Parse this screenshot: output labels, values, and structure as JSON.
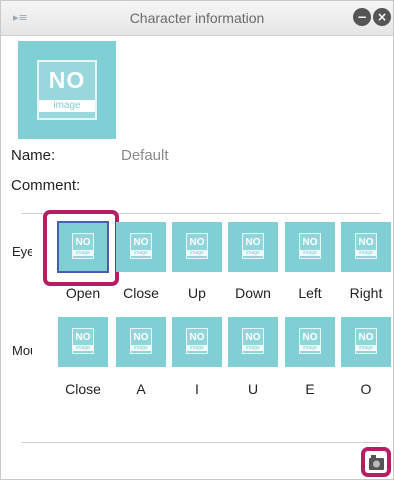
{
  "window": {
    "title": "Character information",
    "grip_icon": "panel-menu-icon",
    "minimize_icon": "minimize-icon",
    "close_icon": "close-icon"
  },
  "portrait": {
    "no_text": "NO",
    "image_text": "image"
  },
  "fields": {
    "name_label": "Name:",
    "name_value": "Default",
    "comment_label": "Comment:"
  },
  "eye": {
    "label": "Eye",
    "items": [
      "Open",
      "Close",
      "Up",
      "Down",
      "Left",
      "Right"
    ],
    "selected_index": 0
  },
  "mouth": {
    "label": "Mouth",
    "items": [
      "Close",
      "A",
      "I",
      "U",
      "E",
      "O"
    ]
  },
  "thumb_placeholder": {
    "no_text": "NO",
    "image_text": "image"
  },
  "footer": {
    "camera_icon": "camera-icon"
  },
  "colors": {
    "placeholder": "#7fcfd4",
    "highlight": "#b41e63",
    "selection": "#4c5db0"
  }
}
